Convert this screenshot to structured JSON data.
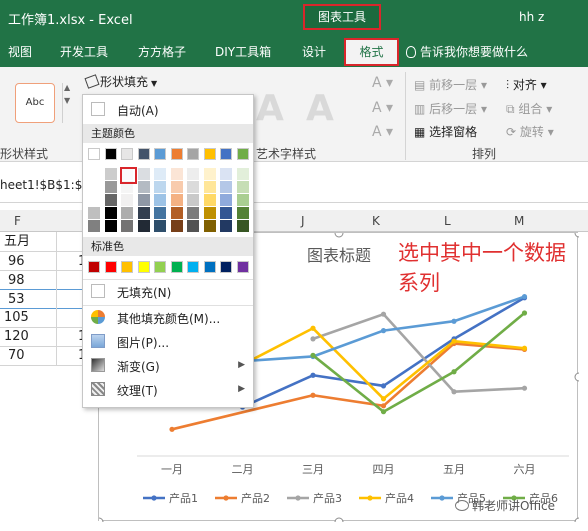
{
  "window": {
    "title": "工作簿1.xlsx  -  Excel",
    "context_group": "图表工具",
    "user": "hh z"
  },
  "tabs": [
    "视图",
    "开发工具",
    "方方格子",
    "DIY工具箱",
    "设计",
    "格式"
  ],
  "tell_me": "告诉我你想要做什么",
  "ribbon": {
    "abc_label": "Abc",
    "shape_fill": "形状填充",
    "shape_styles_group": "形状样式",
    "wordart_group": "艺术字样式",
    "arrange_group": "排列",
    "bring_forward": "前移一层",
    "send_backward": "后移一层",
    "selection_pane": "选择窗格",
    "align": "对齐",
    "group": "组合",
    "rotate": "旋转"
  },
  "formula": {
    "name_box": "heet1!$B$1:$G"
  },
  "columns": [
    "F",
    "J",
    "K",
    "L",
    "M"
  ],
  "sheet": {
    "f_header": "五月",
    "f_values": [
      "96",
      "98",
      "53",
      "105",
      "120",
      "70"
    ],
    "g_partial": [
      "1",
      "1",
      "1"
    ]
  },
  "menu": {
    "auto": "自动(A)",
    "theme_colors": "主题颜色",
    "standard_colors": "标准色",
    "no_fill": "无填充(N)",
    "more_colors": "其他填充颜色(M)...",
    "picture": "图片(P)...",
    "gradient": "渐变(G)",
    "texture": "纹理(T)"
  },
  "colors": {
    "theme_top": [
      "#ffffff",
      "#000000",
      "#e7e6e6",
      "#44546a",
      "#5b9bd5",
      "#ed7d31",
      "#a5a5a5",
      "#ffc000",
      "#4472c4",
      "#70ad47"
    ],
    "standard": [
      "#c00000",
      "#ff0000",
      "#ffc000",
      "#ffff00",
      "#92d050",
      "#00b050",
      "#00b0f0",
      "#0070c0",
      "#002060",
      "#7030a0"
    ],
    "accent_green": "#217346",
    "highlight_red": "#d9262b"
  },
  "annotation": "选中其中一个数据系列",
  "watermark": "韩老师讲Office",
  "chart_data": {
    "type": "line",
    "title": "图表标题",
    "categories": [
      "一月",
      "二月",
      "三月",
      "四月",
      "五月",
      "六月"
    ],
    "series": [
      {
        "name": "产品1",
        "color": "#4472c4",
        "values": [
          null,
          40,
          67,
          58,
          98,
          133
        ]
      },
      {
        "name": "产品2",
        "color": "#ed7d31",
        "values": [
          21,
          null,
          50,
          41,
          94,
          89
        ]
      },
      {
        "name": "产品3",
        "color": "#a5a5a5",
        "values": [
          null,
          null,
          98,
          119,
          53,
          56
        ]
      },
      {
        "name": "产品4",
        "color": "#ffc000",
        "values": [
          null,
          76,
          107,
          47,
          96,
          90
        ]
      },
      {
        "name": "产品5",
        "color": "#5b9bd5",
        "values": [
          null,
          79,
          83,
          105,
          113,
          134
        ]
      },
      {
        "name": "产品6",
        "color": "#70ad47",
        "values": [
          null,
          null,
          84,
          36,
          70,
          120
        ]
      }
    ],
    "ylim": [
      0,
      160
    ],
    "legend": "bottom"
  }
}
